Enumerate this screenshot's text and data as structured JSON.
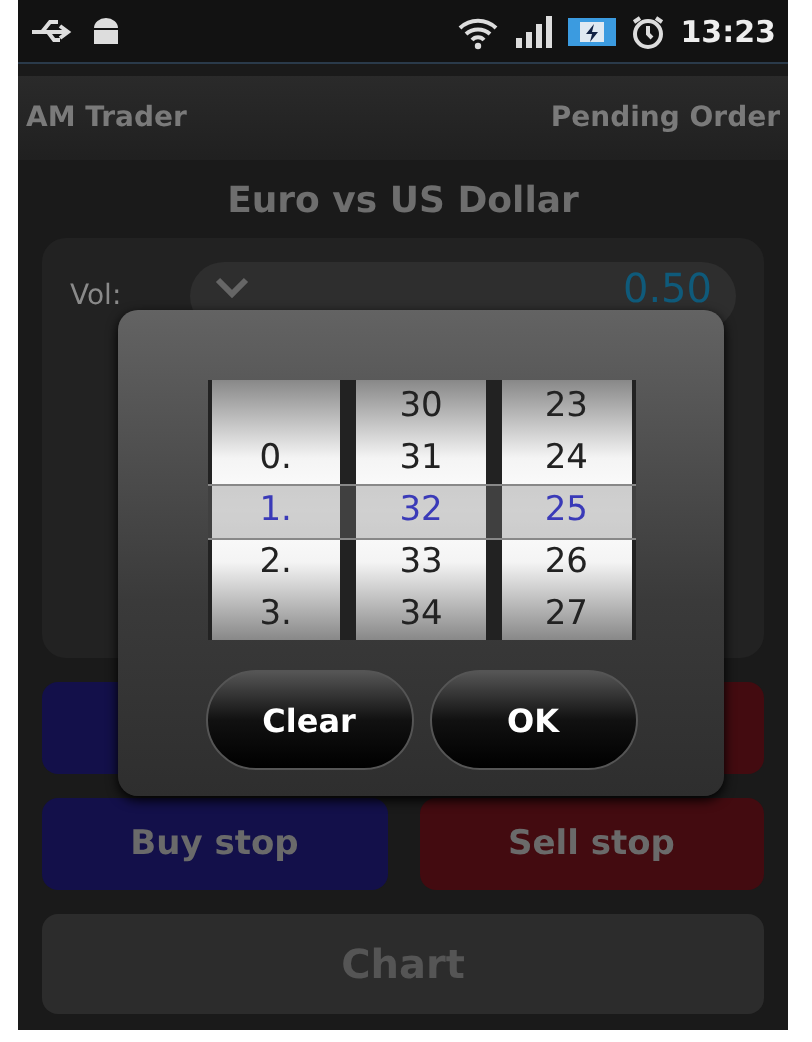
{
  "status_bar": {
    "time": "13:23"
  },
  "header": {
    "app_name": "AM Trader",
    "screen_title": "Pending Order"
  },
  "pair_title": "Euro vs US Dollar",
  "volume": {
    "label": "Vol:",
    "value": "0.50"
  },
  "buttons": [
    {
      "label": "Buy stop",
      "kind": "buy"
    },
    {
      "label": "Sell stop",
      "kind": "sell"
    }
  ],
  "chart_button": "Chart",
  "picker": {
    "columns": [
      {
        "items": [
          {
            "value": "0.",
            "selected": false
          },
          {
            "value": "1.",
            "selected": true
          },
          {
            "value": "2.",
            "selected": false
          },
          {
            "value": "3.",
            "selected": false
          }
        ]
      },
      {
        "items": [
          {
            "value": "30",
            "selected": false
          },
          {
            "value": "31",
            "selected": false
          },
          {
            "value": "32",
            "selected": true
          },
          {
            "value": "33",
            "selected": false
          },
          {
            "value": "34",
            "selected": false
          }
        ]
      },
      {
        "items": [
          {
            "value": "23",
            "selected": false
          },
          {
            "value": "24",
            "selected": false
          },
          {
            "value": "25",
            "selected": true
          },
          {
            "value": "26",
            "selected": false
          },
          {
            "value": "27",
            "selected": false
          }
        ]
      }
    ],
    "buttons": [
      "Clear",
      "OK"
    ]
  }
}
